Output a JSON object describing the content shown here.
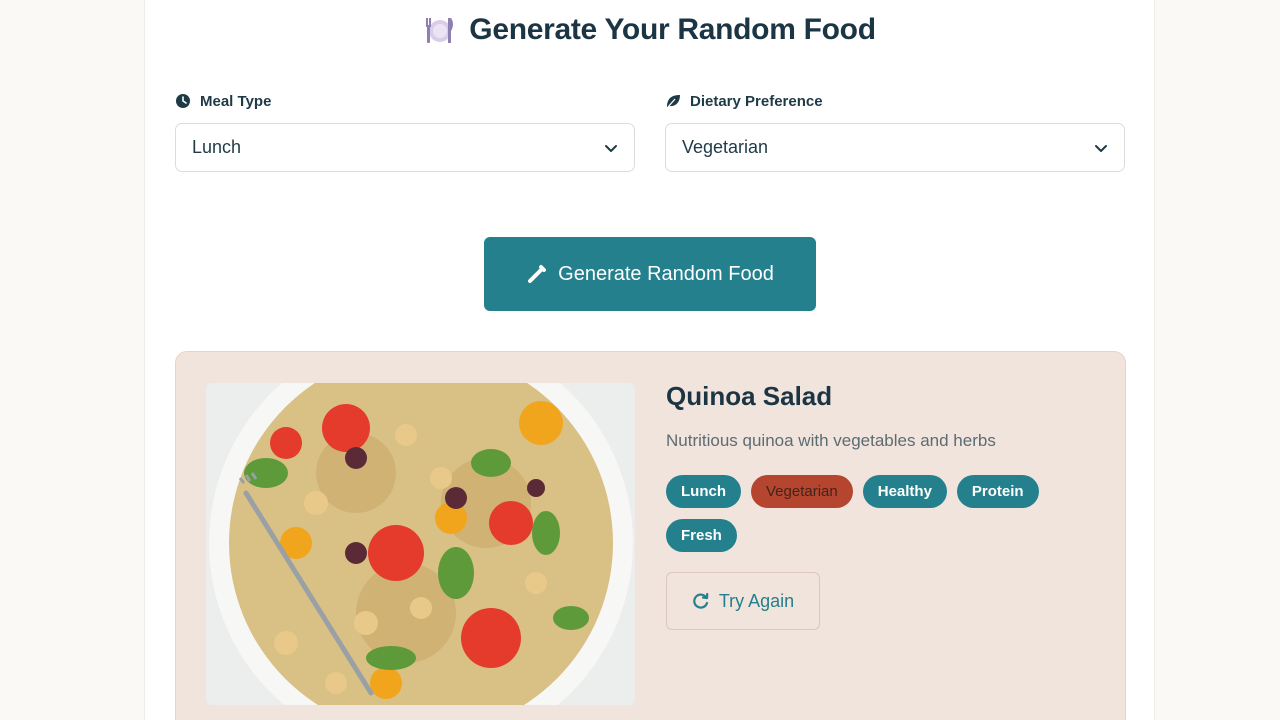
{
  "header": {
    "title": "Generate Your Random Food",
    "title_icon": "plate-utensils-icon"
  },
  "filters": {
    "meal_type": {
      "label": "Meal Type",
      "icon": "clock-icon",
      "value": "Lunch"
    },
    "dietary": {
      "label": "Dietary Preference",
      "icon": "leaf-icon",
      "value": "Vegetarian"
    }
  },
  "generate_button": {
    "label": "Generate Random Food",
    "icon": "magic-wand-icon"
  },
  "result": {
    "name": "Quinoa Salad",
    "description": "Nutritious quinoa with vegetables and herbs",
    "tags": [
      "Lunch",
      "Vegetarian",
      "Healthy",
      "Protein",
      "Fresh"
    ],
    "try_again_label": "Try Again",
    "try_again_icon": "refresh-icon"
  },
  "colors": {
    "primary": "#23808c",
    "card_bg": "#f1e4dc",
    "diet_tag": "#b5452f",
    "heading": "#1c3544"
  }
}
